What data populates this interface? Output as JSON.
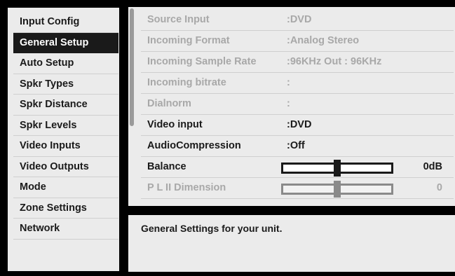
{
  "menu": {
    "items": [
      {
        "label": "Input Config"
      },
      {
        "label": "General Setup",
        "selected": true
      },
      {
        "label": "Auto Setup"
      },
      {
        "label": "Spkr Types"
      },
      {
        "label": "Spkr Distance"
      },
      {
        "label": "Spkr Levels"
      },
      {
        "label": "Video Inputs"
      },
      {
        "label": "Video Outputs"
      },
      {
        "label": "Mode"
      },
      {
        "label": "Zone Settings"
      },
      {
        "label": "Network"
      }
    ]
  },
  "settings": {
    "rows": [
      {
        "label": "Source Input",
        "value": ":DVD"
      },
      {
        "label": "Incoming Format",
        "value": ":Analog Stereo"
      },
      {
        "label": "Incoming Sample Rate",
        "value": ":96KHz Out : 96KHz"
      },
      {
        "label": "Incoming bitrate",
        "value": ":"
      },
      {
        "label": "Dialnorm",
        "value": ":"
      },
      {
        "label": "Video input",
        "value": ":DVD"
      },
      {
        "label": "AudioCompression",
        "value": ":Off"
      },
      {
        "label": "Balance",
        "value": "0dB"
      },
      {
        "label": "P L II Dimension",
        "value": "0"
      }
    ],
    "sliders": {
      "balance_fraction": 0.5,
      "pl2_dimension_fraction": 0.5
    }
  },
  "description": {
    "text": "General Settings for your unit."
  },
  "colors": {
    "panel": "#ebebeb",
    "background": "#000000",
    "text": "#1a1a1a",
    "dim_text": "#a8a8a8"
  }
}
